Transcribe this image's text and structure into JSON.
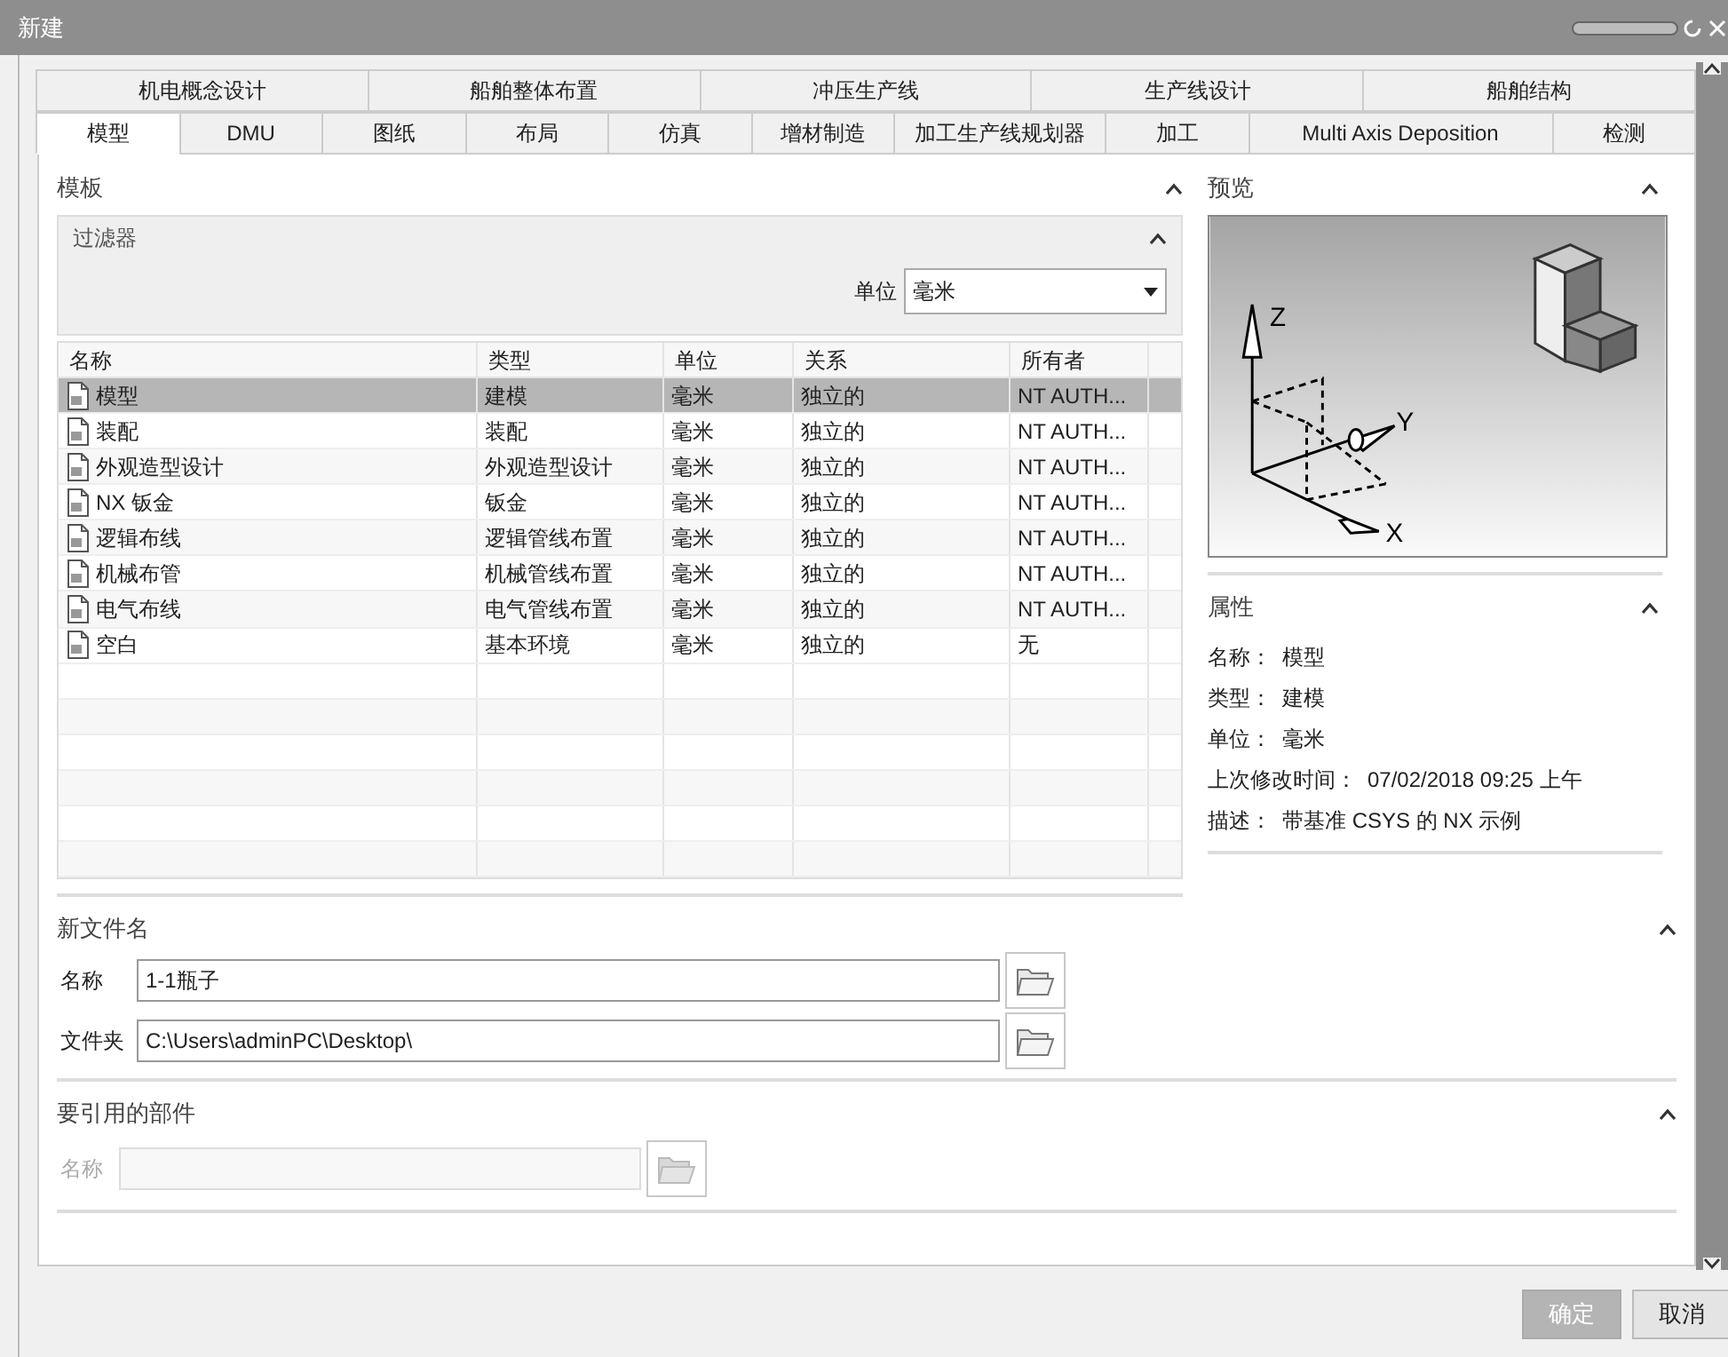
{
  "window": {
    "title": "新建"
  },
  "tabs_top": [
    {
      "label": "机电概念设计",
      "selected": false
    },
    {
      "label": "船舶整体布置",
      "selected": false
    },
    {
      "label": "冲压生产线",
      "selected": false
    },
    {
      "label": "生产线设计",
      "selected": false
    },
    {
      "label": "船舶结构",
      "selected": false
    }
  ],
  "tabs": [
    {
      "label": "模型",
      "selected": true
    },
    {
      "label": "DMU",
      "selected": false
    },
    {
      "label": "图纸",
      "selected": false
    },
    {
      "label": "布局",
      "selected": false
    },
    {
      "label": "仿真",
      "selected": false
    },
    {
      "label": "增材制造",
      "selected": false
    },
    {
      "label": "加工生产线规划器",
      "selected": false
    },
    {
      "label": "加工",
      "selected": false
    },
    {
      "label": "Multi Axis Deposition",
      "selected": false
    },
    {
      "label": "检测",
      "selected": false
    }
  ],
  "template": {
    "title": "模板"
  },
  "filter": {
    "title": "过滤器",
    "unit_label": "单位",
    "unit_value": "毫米"
  },
  "table": {
    "columns": [
      "名称",
      "类型",
      "单位",
      "关系",
      "所有者"
    ],
    "rows": [
      {
        "name": "模型",
        "type": "建模",
        "unit": "毫米",
        "relation": "独立的",
        "owner": "NT AUTH...",
        "selected": true
      },
      {
        "name": "装配",
        "type": "装配",
        "unit": "毫米",
        "relation": "独立的",
        "owner": "NT AUTH...",
        "selected": false
      },
      {
        "name": "外观造型设计",
        "type": "外观造型设计",
        "unit": "毫米",
        "relation": "独立的",
        "owner": "NT AUTH...",
        "selected": false
      },
      {
        "name": "NX 钣金",
        "type": "钣金",
        "unit": "毫米",
        "relation": "独立的",
        "owner": "NT AUTH...",
        "selected": false
      },
      {
        "name": "逻辑布线",
        "type": "逻辑管线布置",
        "unit": "毫米",
        "relation": "独立的",
        "owner": "NT AUTH...",
        "selected": false
      },
      {
        "name": "机械布管",
        "type": "机械管线布置",
        "unit": "毫米",
        "relation": "独立的",
        "owner": "NT AUTH...",
        "selected": false
      },
      {
        "name": "电气布线",
        "type": "电气管线布置",
        "unit": "毫米",
        "relation": "独立的",
        "owner": "NT AUTH...",
        "selected": false
      },
      {
        "name": "空白",
        "type": "基本环境",
        "unit": "毫米",
        "relation": "独立的",
        "owner": "无",
        "selected": false
      }
    ]
  },
  "preview": {
    "title": "预览",
    "axis_labels": [
      "Z",
      "Y",
      "X"
    ]
  },
  "properties": {
    "title": "属性",
    "items": [
      {
        "label": "名称：",
        "value": "模型"
      },
      {
        "label": "类型：",
        "value": "建模"
      },
      {
        "label": "单位：",
        "value": "毫米"
      },
      {
        "label": "上次修改时间：",
        "value": "07/02/2018 09:25 上午"
      },
      {
        "label": "描述：",
        "value": "带基准 CSYS 的 NX 示例"
      }
    ]
  },
  "new_file": {
    "title": "新文件名",
    "fields": [
      {
        "label": "名称",
        "value": "1-1瓶子",
        "disabled": false
      },
      {
        "label": "文件夹",
        "value": "C:\\Users\\adminPC\\Desktop\\",
        "disabled": false
      }
    ]
  },
  "referenced_parts": {
    "title": "要引用的部件",
    "fields": [
      {
        "label": "名称",
        "disabled": true
      }
    ]
  },
  "buttons": [
    {
      "label": "确定",
      "disabled": true
    },
    {
      "label": "取消",
      "disabled": false
    }
  ]
}
